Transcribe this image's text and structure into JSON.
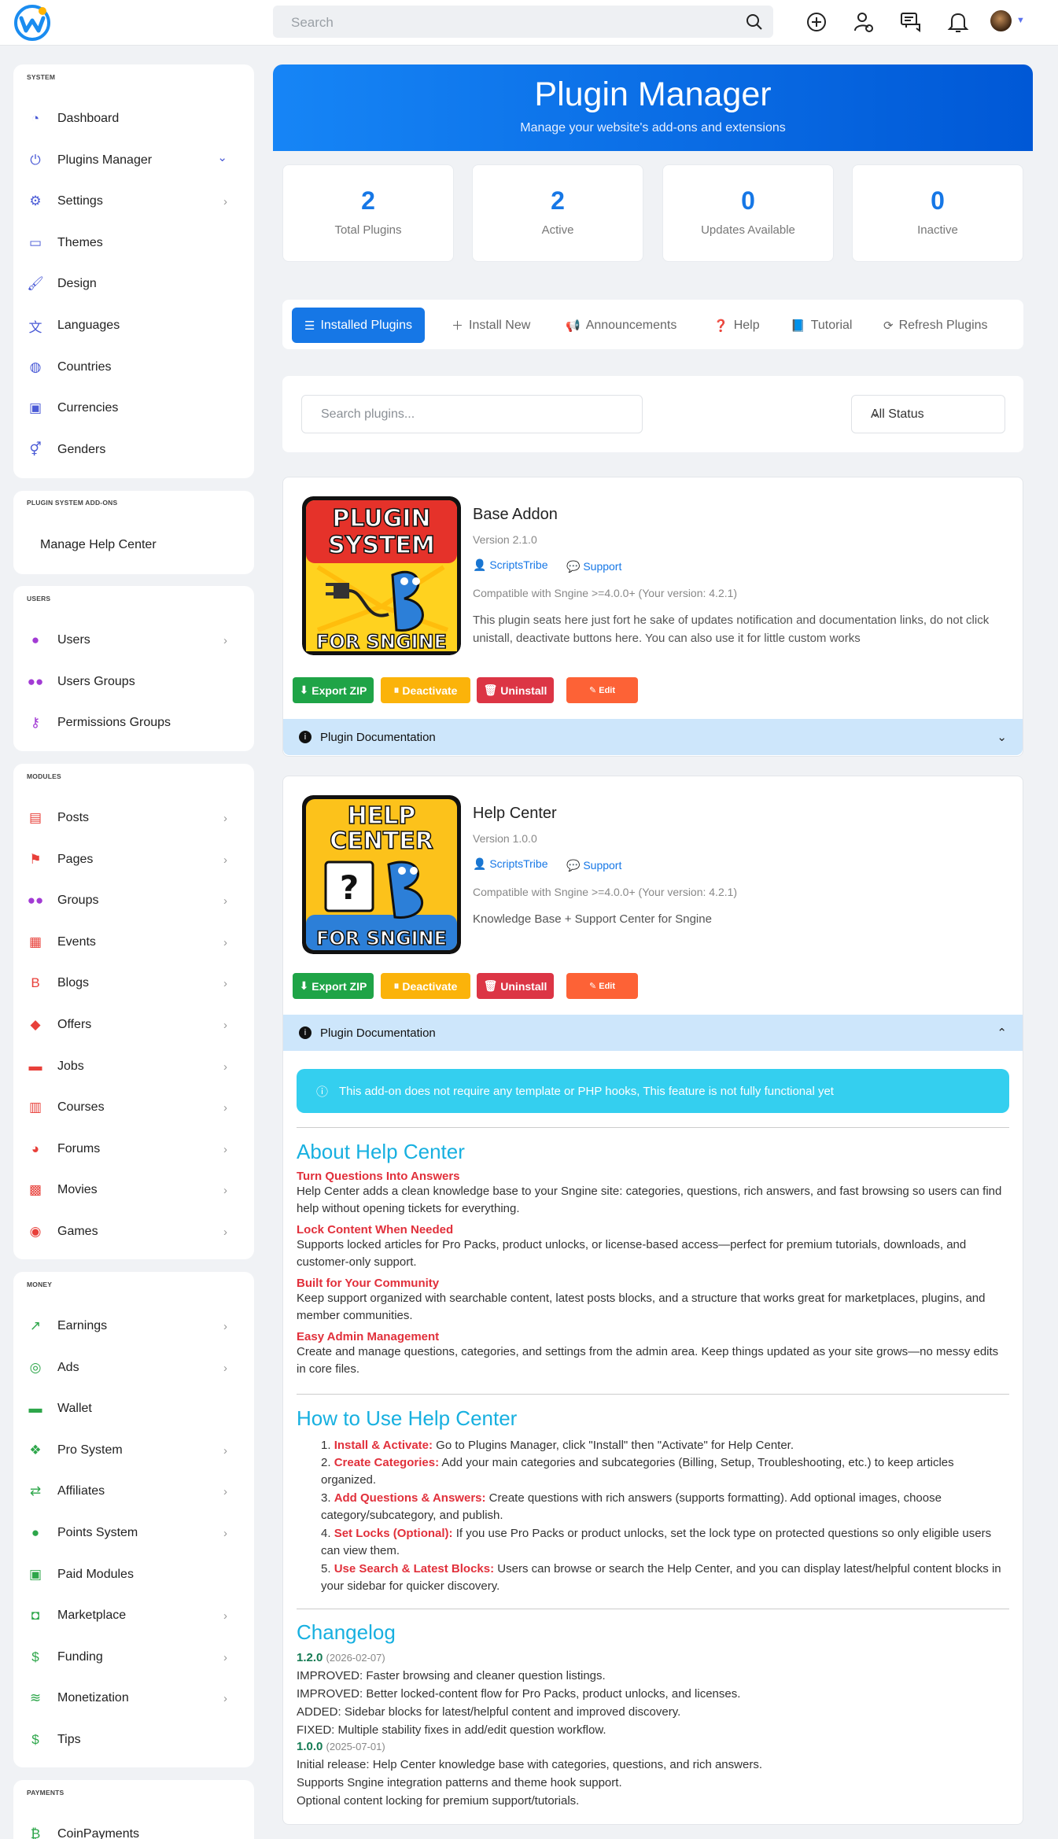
{
  "topbar": {
    "search_placeholder": "Search"
  },
  "sidebar": {
    "system": {
      "header": "SYSTEM",
      "items": [
        {
          "label": "Dashboard",
          "icon": "gauge-icon"
        },
        {
          "label": "Plugins Manager",
          "icon": "plug-icon"
        },
        {
          "label": "Settings",
          "icon": "gear-icon"
        },
        {
          "label": "Themes",
          "icon": "monitor-icon"
        },
        {
          "label": "Design",
          "icon": "brush-icon"
        },
        {
          "label": "Languages",
          "icon": "translate-icon"
        },
        {
          "label": "Countries",
          "icon": "globe-icon"
        },
        {
          "label": "Currencies",
          "icon": "money-bill-icon"
        },
        {
          "label": "Genders",
          "icon": "gender-icon"
        }
      ]
    },
    "addons": {
      "header": "PLUGIN SYSTEM ADD-ONS",
      "items": [
        {
          "label": "Manage Help Center"
        }
      ]
    },
    "users": {
      "header": "USERS",
      "items": [
        {
          "label": "Users",
          "icon": "user-icon"
        },
        {
          "label": "Users Groups",
          "icon": "users-icon"
        },
        {
          "label": "Permissions Groups",
          "icon": "key-icon"
        }
      ]
    },
    "modules": {
      "header": "MODULES",
      "items": [
        {
          "label": "Posts",
          "icon": "newspaper-icon"
        },
        {
          "label": "Pages",
          "icon": "flag-icon"
        },
        {
          "label": "Groups",
          "icon": "users-icon"
        },
        {
          "label": "Events",
          "icon": "calendar-icon"
        },
        {
          "label": "Blogs",
          "icon": "blog-icon"
        },
        {
          "label": "Offers",
          "icon": "tag-icon"
        },
        {
          "label": "Jobs",
          "icon": "briefcase-icon"
        },
        {
          "label": "Courses",
          "icon": "book-icon"
        },
        {
          "label": "Forums",
          "icon": "comments-icon"
        },
        {
          "label": "Movies",
          "icon": "film-icon"
        },
        {
          "label": "Games",
          "icon": "gamepad-icon"
        }
      ]
    },
    "money": {
      "header": "MONEY",
      "items": [
        {
          "label": "Earnings",
          "icon": "chart-line-icon"
        },
        {
          "label": "Ads",
          "icon": "target-icon"
        },
        {
          "label": "Wallet",
          "icon": "wallet-icon"
        },
        {
          "label": "Pro System",
          "icon": "cubes-icon"
        },
        {
          "label": "Affiliates",
          "icon": "exchange-icon"
        },
        {
          "label": "Points System",
          "icon": "piggy-bank-icon"
        },
        {
          "label": "Paid Modules",
          "icon": "money-card-icon"
        },
        {
          "label": "Marketplace",
          "icon": "shopping-bag-icon"
        },
        {
          "label": "Funding",
          "icon": "hand-holding-dollar-icon"
        },
        {
          "label": "Monetization",
          "icon": "coins-icon"
        },
        {
          "label": "Tips",
          "icon": "dollar-icon"
        }
      ]
    },
    "payments": {
      "header": "PAYMENTS",
      "items": [
        {
          "label": "CoinPayments",
          "icon": "bitcoin-icon"
        }
      ]
    }
  },
  "hero": {
    "title": "Plugin Manager",
    "subtitle": "Manage your website's add-ons and extensions"
  },
  "stats": [
    {
      "value": "2",
      "label": "Total Plugins"
    },
    {
      "value": "2",
      "label": "Active"
    },
    {
      "value": "0",
      "label": "Updates Available"
    },
    {
      "value": "0",
      "label": "Inactive"
    }
  ],
  "tabs": [
    "Installed Plugins",
    "Install New",
    "Announcements",
    "Help",
    "Tutorial",
    "Refresh Plugins"
  ],
  "filter": {
    "search_placeholder": "Search plugins...",
    "status": "All Status"
  },
  "buttons": {
    "export": "Export ZIP",
    "deactivate": "Deactivate",
    "uninstall": "Uninstall",
    "edit": "Edit",
    "doc": "Plugin Documentation"
  },
  "plugins": [
    {
      "name": "Base Addon",
      "version": "Version 2.1.0",
      "author": "ScriptsTribe",
      "support": "Support",
      "compat": "Compatible with Sngine >=4.0.0+ (Your version: 4.2.1)",
      "desc": "This plugin seats here just fort he sake of updates notification and documentation links, do not click unistall, deactivate buttons here. You can also use it for little custom works",
      "img": [
        "PLUGIN",
        "SYSTEM",
        "FOR SNGINE"
      ]
    },
    {
      "name": "Help Center",
      "version": "Version 1.0.0",
      "author": "ScriptsTribe",
      "support": "Support",
      "compat": "Compatible with Sngine >=4.0.0+ (Your version: 4.2.1)",
      "desc": "Knowledge Base + Support Center for Sngine",
      "img": [
        "HELP",
        "CENTER",
        "FOR SNGINE"
      ]
    }
  ],
  "doc": {
    "alert": "This add-on does not require any template or PHP hooks, This feature is not fully functional yet",
    "about_title": "About Help Center",
    "about": [
      {
        "h": "Turn Questions Into Answers",
        "t": "Help Center adds a clean knowledge base to your Sngine site: categories, questions, rich answers, and fast browsing so users can find help without opening tickets for everything."
      },
      {
        "h": "Lock Content When Needed",
        "t": "Supports locked articles for Pro Packs, product unlocks, or license-based access—perfect for premium tutorials, downloads, and customer-only support."
      },
      {
        "h": "Built for Your Community",
        "t": "Keep support organized with searchable content, latest posts blocks, and a structure that works great for marketplaces, plugins, and member communities."
      },
      {
        "h": "Easy Admin Management",
        "t": "Create and manage questions, categories, and settings from the admin area. Keep things updated as your site grows—no messy edits in core files."
      }
    ],
    "howto_title": "How to Use Help Center",
    "howto": [
      {
        "b": "Install & Activate:",
        "t": " Go to Plugins Manager, click \"Install\" then \"Activate\" for Help Center."
      },
      {
        "b": "Create Categories:",
        "t": " Add your main categories and subcategories (Billing, Setup, Troubleshooting, etc.) to keep articles organized."
      },
      {
        "b": "Add Questions & Answers:",
        "t": " Create questions with rich answers (supports formatting). Add optional images, choose category/subcategory, and publish."
      },
      {
        "b": "Set Locks (Optional):",
        "t": " If you use Pro Packs or product unlocks, set the lock type on protected questions so only eligible users can view them."
      },
      {
        "b": "Use Search & Latest Blocks:",
        "t": " Users can browse or search the Help Center, and you can display latest/helpful content blocks in your sidebar for quicker discovery."
      }
    ],
    "changelog_title": "Changelog",
    "changelog": [
      {
        "v": "1.2.0",
        "d": "(2026-02-07)",
        "lines": [
          "IMPROVED: Faster browsing and cleaner question listings.",
          "IMPROVED: Better locked-content flow for Pro Packs, product unlocks, and licenses.",
          "ADDED: Sidebar blocks for latest/helpful content and improved discovery.",
          "FIXED: Multiple stability fixes in add/edit question workflow."
        ]
      },
      {
        "v": "1.0.0",
        "d": "(2025-07-01)",
        "lines": [
          "Initial release: Help Center knowledge base with categories, questions, and rich answers.",
          "Supports Sngine integration patterns and theme hook support.",
          "Optional content locking for premium support/tutorials."
        ]
      }
    ]
  },
  "colors": {
    "accent": "#1677e6",
    "hero_start": "#1685f6",
    "hero_end": "#0058d6",
    "export": "#1fa447",
    "deactivate": "#fbb30a",
    "uninstall": "#dc3545",
    "edit": "#fd6236",
    "doc_bar": "#cde6fb",
    "alert": "#34cfef",
    "heading": "#17b0e0",
    "red_heading": "#e1303b",
    "version": "#137a52"
  }
}
